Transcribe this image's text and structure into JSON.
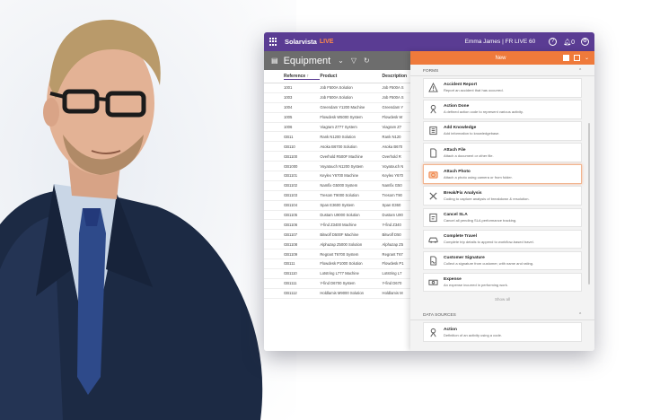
{
  "app": {
    "brand": "Solarvista",
    "brand_tag": "LIVE",
    "user": "Emma James | FR LIVE 60",
    "notif_count": "0"
  },
  "toolbar": {
    "title": "Equipment"
  },
  "table": {
    "headers": [
      "Reference",
      "Product",
      "Description"
    ],
    "rows": [
      [
        "1001",
        "Job F500A Solution",
        "Job F500A S"
      ],
      [
        "1003",
        "Job F500A Solution",
        "Job F500A S"
      ],
      [
        "1004",
        "Greendam Y1200 Machine",
        "Greendam Y"
      ],
      [
        "1005",
        "Flowdesk W5000 System",
        "Flowdesk W"
      ],
      [
        "1006",
        "Viagram Z777 System",
        "Viagram Z7"
      ],
      [
        "GB11",
        "Rank N1200 Solution",
        "Rank N120"
      ],
      [
        "GB110",
        "Asoka B6700 Solution",
        "Asoka B670"
      ],
      [
        "GB1100",
        "Overhold R500F Machine",
        "Overhold R"
      ],
      [
        "GB1000",
        "Voyatouch N1200 System",
        "Voyatouch N"
      ],
      [
        "GB1101",
        "Keylex Y6700 Machine",
        "Keylex Y670"
      ],
      [
        "GB1102",
        "Namfix G5000 System",
        "Namfix G50"
      ],
      [
        "GB1103",
        "Tresom T9000 Solution",
        "Tresom T90"
      ],
      [
        "GB1104",
        "Span E3600 System",
        "Span E360"
      ],
      [
        "GB1105",
        "Dustam U9000 Solution",
        "Dustam U90"
      ],
      [
        "GB1106",
        "Y-find Z3400 Machine",
        "Y-find Z340"
      ],
      [
        "GB1107",
        "Bitwolf D500F Machine",
        "Bitwolf D50"
      ],
      [
        "GB1108",
        "Alphazap Z5000 Solution",
        "Alphazap Z5"
      ],
      [
        "GB1109",
        "Regrant T6700 System",
        "Regrant T67"
      ],
      [
        "GB111",
        "Flowdesk P1000 Solution",
        "Flowdesk P1"
      ],
      [
        "GB1110",
        "Lotstring L777 Machine",
        "Lotstring L7"
      ],
      [
        "GB1111",
        "Y-find D6700 System",
        "Y-find D670"
      ],
      [
        "GB1112",
        "Holdlamis M9000 Solution",
        "Holdlamis M"
      ]
    ]
  },
  "panel": {
    "title": "New",
    "forms_label": "FORMS",
    "forms": [
      {
        "title": "Accident Report",
        "desc": "Report an accident that has occurred.",
        "icon": "warning-icon"
      },
      {
        "title": "Action Done",
        "desc": "A defined action code to represent various activity.",
        "icon": "action-icon"
      },
      {
        "title": "Add Knowledge",
        "desc": "Add information to knowledgebase.",
        "icon": "knowledge-icon"
      },
      {
        "title": "Attach File",
        "desc": "Attach a document or other file.",
        "icon": "file-icon"
      },
      {
        "title": "Attach Photo",
        "desc": "Attach a photo using camera or from folder.",
        "icon": "camera-icon"
      },
      {
        "title": "Break/Fix Analysis",
        "desc": "Coding to capture analysis of breakdown & resolution.",
        "icon": "tools-icon"
      },
      {
        "title": "Cancel SLA",
        "desc": "Cancel all pending SLA performance tracking.",
        "icon": "sla-icon"
      },
      {
        "title": "Complete Travel",
        "desc": "Complete trip details to append to workflow-based travel.",
        "icon": "car-icon"
      },
      {
        "title": "Customer Signature",
        "desc": "Collect a signature from customer, with name and rating.",
        "icon": "signature-icon"
      },
      {
        "title": "Expense",
        "desc": "An expense incurred in performing work.",
        "icon": "money-icon"
      }
    ],
    "show_all": "Show all",
    "data_sources_label": "DATA SOURCES",
    "data_sources": [
      {
        "title": "Action",
        "desc": "Definition of an activity using a code.",
        "icon": "action-icon"
      }
    ]
  }
}
